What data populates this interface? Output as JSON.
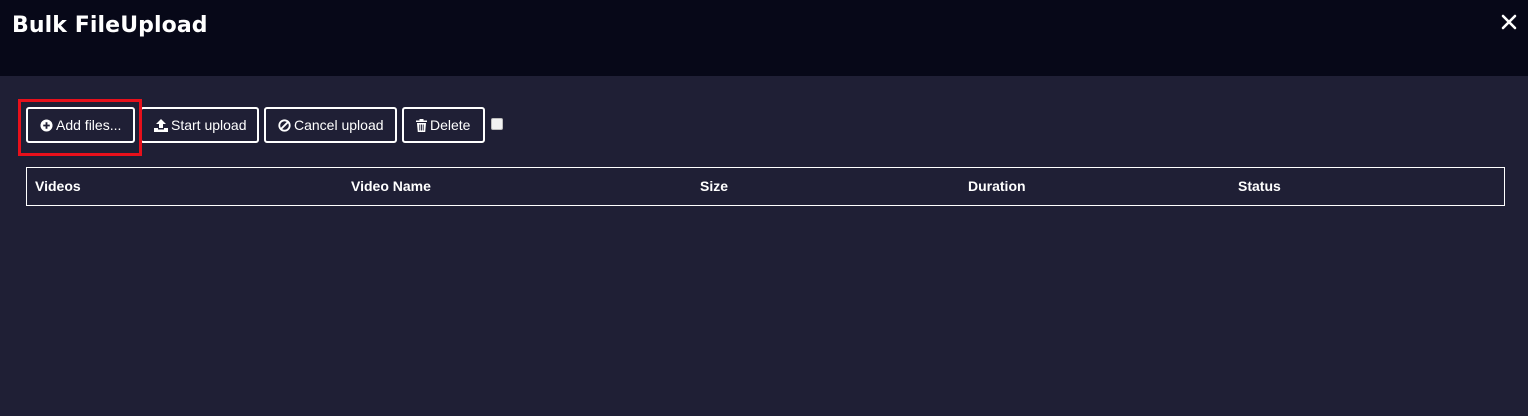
{
  "header": {
    "title": "Bulk FileUpload",
    "close_icon": "close-icon"
  },
  "toolbar": {
    "add_files_label": "Add files...",
    "add_files_icon": "plus-circle-icon",
    "start_upload_label": "Start upload",
    "start_upload_icon": "upload-icon",
    "cancel_upload_label": "Cancel upload",
    "cancel_upload_icon": "ban-icon",
    "delete_label": "Delete",
    "delete_icon": "trash-icon",
    "select_all_checked": false
  },
  "table": {
    "columns": [
      "Videos",
      "Video Name",
      "Size",
      "Duration",
      "Status"
    ],
    "rows": []
  },
  "colors": {
    "header_bg": "#070818",
    "body_bg": "#1f1f35",
    "highlight": "#e8101b",
    "text": "#ffffff"
  }
}
